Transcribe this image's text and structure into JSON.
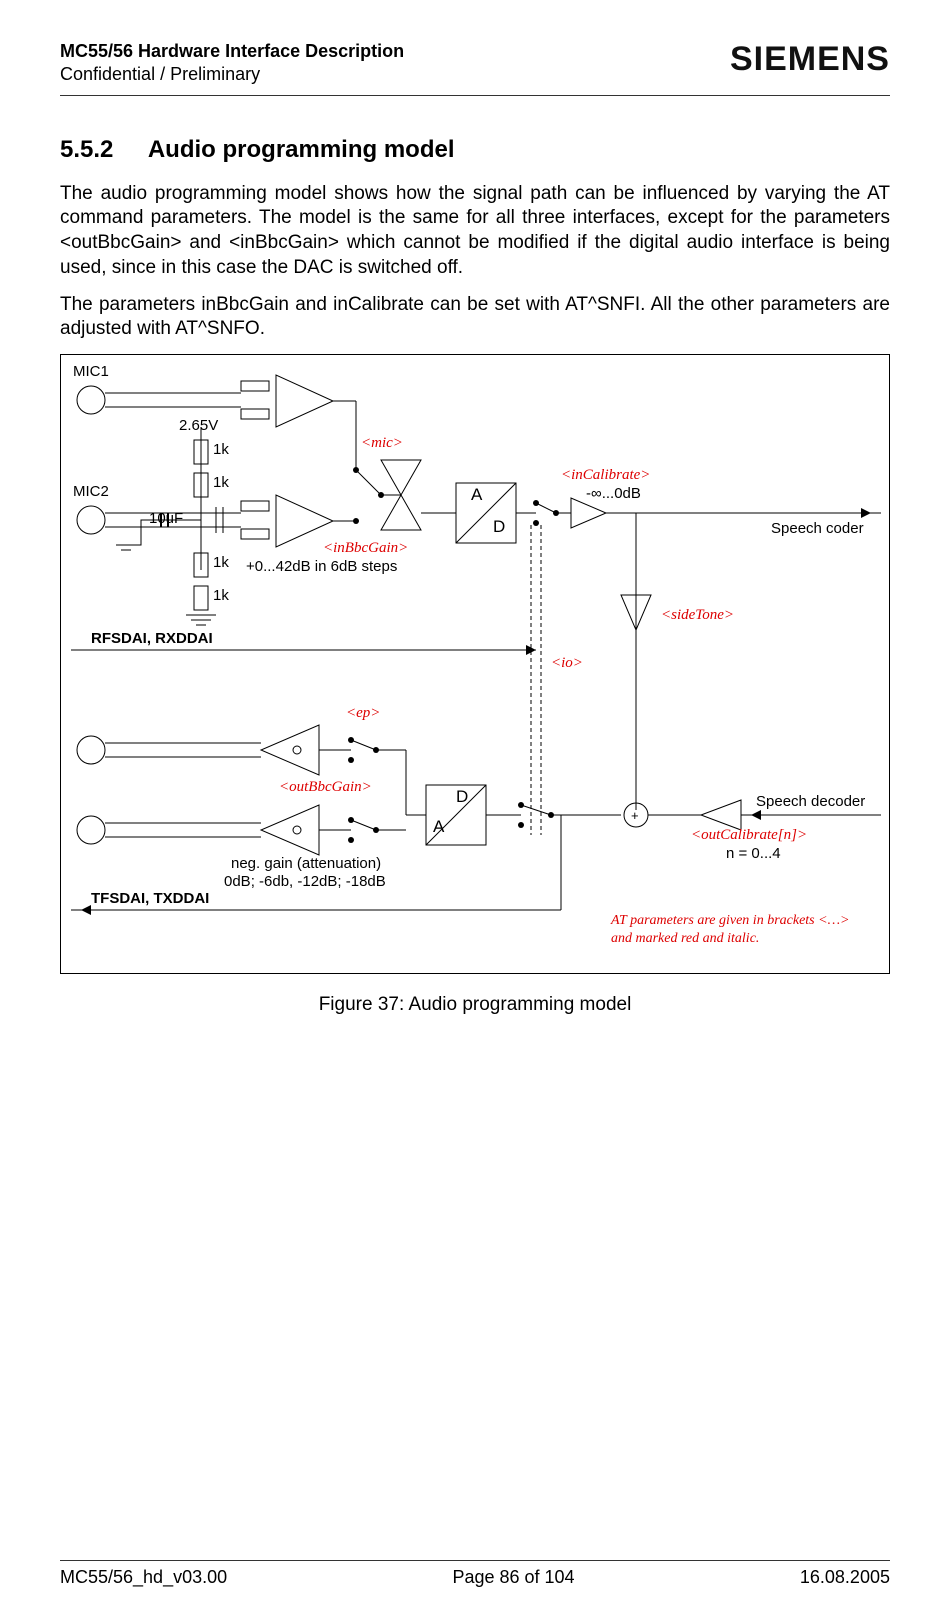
{
  "header": {
    "title": "MC55/56 Hardware Interface Description",
    "subtitle": "Confidential / Preliminary",
    "logo": "SIEMENS"
  },
  "section": {
    "number": "5.5.2",
    "title": "Audio programming model"
  },
  "para1": "The audio programming model shows how the signal path can be influenced by varying the AT command parameters. The model is the same for all three interfaces, except for the parameters <outBbcGain> and <inBbcGain> which cannot be modified if the digital audio interface is being used, since in this case the DAC is switched off.",
  "para2": "The parameters inBbcGain and inCalibrate can be set with AT^SNFI. All the other parameters are adjusted with AT^SNFO.",
  "figure": {
    "mic1": "MIC1",
    "mic2": "MIC2",
    "v": "2.65V",
    "r1": "1k",
    "r2": "1k",
    "r3": "1k",
    "r4": "1k",
    "cap": "10uF",
    "mic_param": "<mic>",
    "inBbc": "<inBbcGain>",
    "inBbc_note": "+0...42dB in 6dB steps",
    "adA": "A",
    "adD": "D",
    "inCal": "<inCalibrate>",
    "inCal_note": "-∞...0dB",
    "speechCoder": "Speech coder",
    "rfsdai": "RFSDAI, RXDDAI",
    "sideTone": "<sideTone>",
    "io": "<io>",
    "ep": "<ep>",
    "outBbc": "<outBbcGain>",
    "daD": "D",
    "daA": "A",
    "negGain1": "neg. gain (attenuation)",
    "negGain2": "0dB; -6db, -12dB; -18dB",
    "tfsdai": "TFSDAI, TXDDAI",
    "speechDecoder": "Speech decoder",
    "outCal": "<outCalibrate[n]>",
    "outCal_note": "n = 0...4",
    "note1": "AT parameters are given in brackets <…>",
    "note2": "and marked red and italic.",
    "plus": "+"
  },
  "caption": "Figure 37: Audio programming model",
  "footer": {
    "left": "MC55/56_hd_v03.00",
    "center": "Page 86 of 104",
    "right": "16.08.2005"
  }
}
